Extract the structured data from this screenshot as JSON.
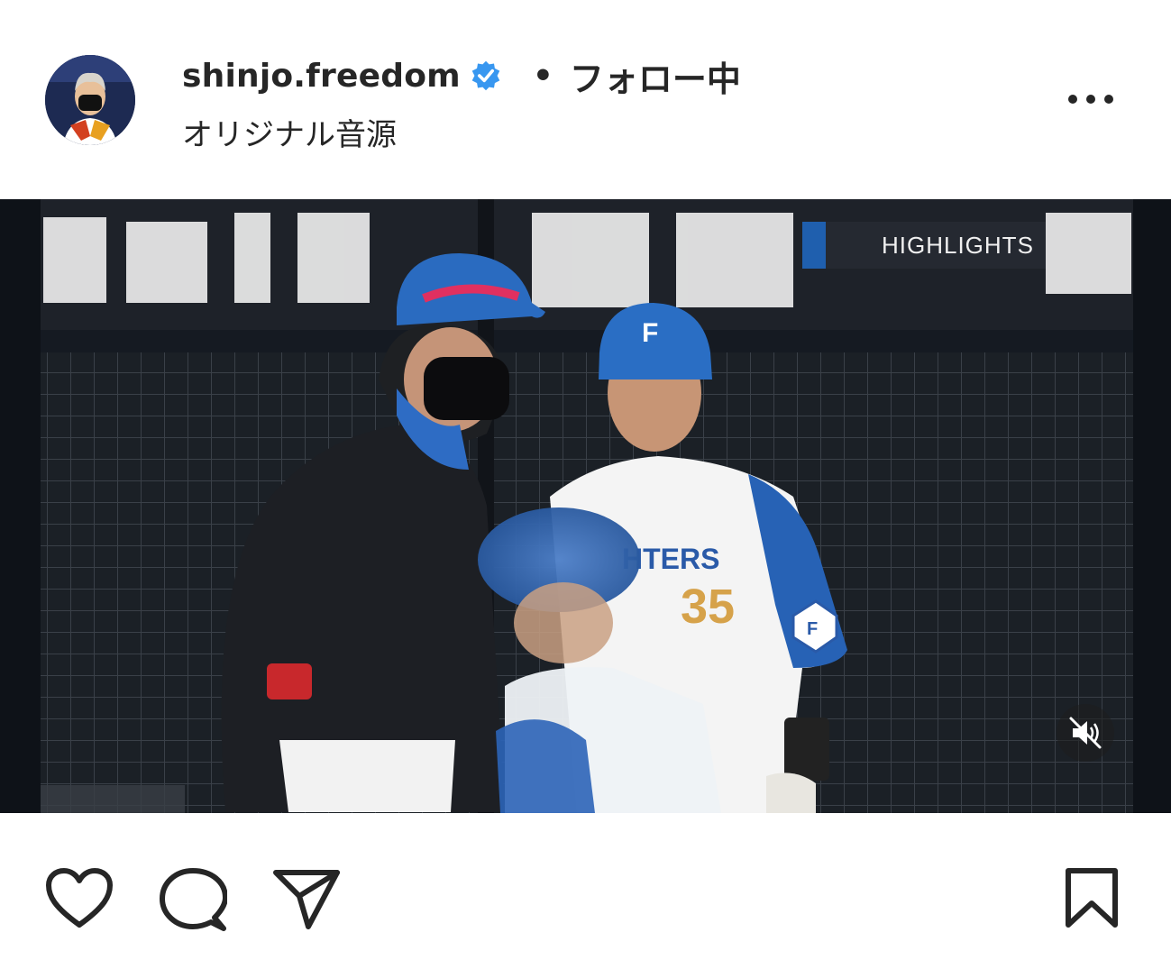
{
  "header": {
    "username": "shinjo.freedom",
    "separator": "•",
    "follow_label": "フォロー中",
    "audio_label": "オリジナル音源",
    "more_icon": "more-horizontal-icon"
  },
  "video": {
    "overlay_label": "HIGHLIGHTS",
    "mute_icon": "muted-speaker-icon",
    "jersey_number": "35",
    "jersey_text": "HTERS",
    "accent_color": "#1f5fae"
  },
  "actions": {
    "like_icon": "heart-icon",
    "comment_icon": "comment-icon",
    "share_icon": "send-icon",
    "save_icon": "bookmark-icon"
  },
  "colors": {
    "verified_badge": "#3897f0",
    "text": "#262626"
  }
}
